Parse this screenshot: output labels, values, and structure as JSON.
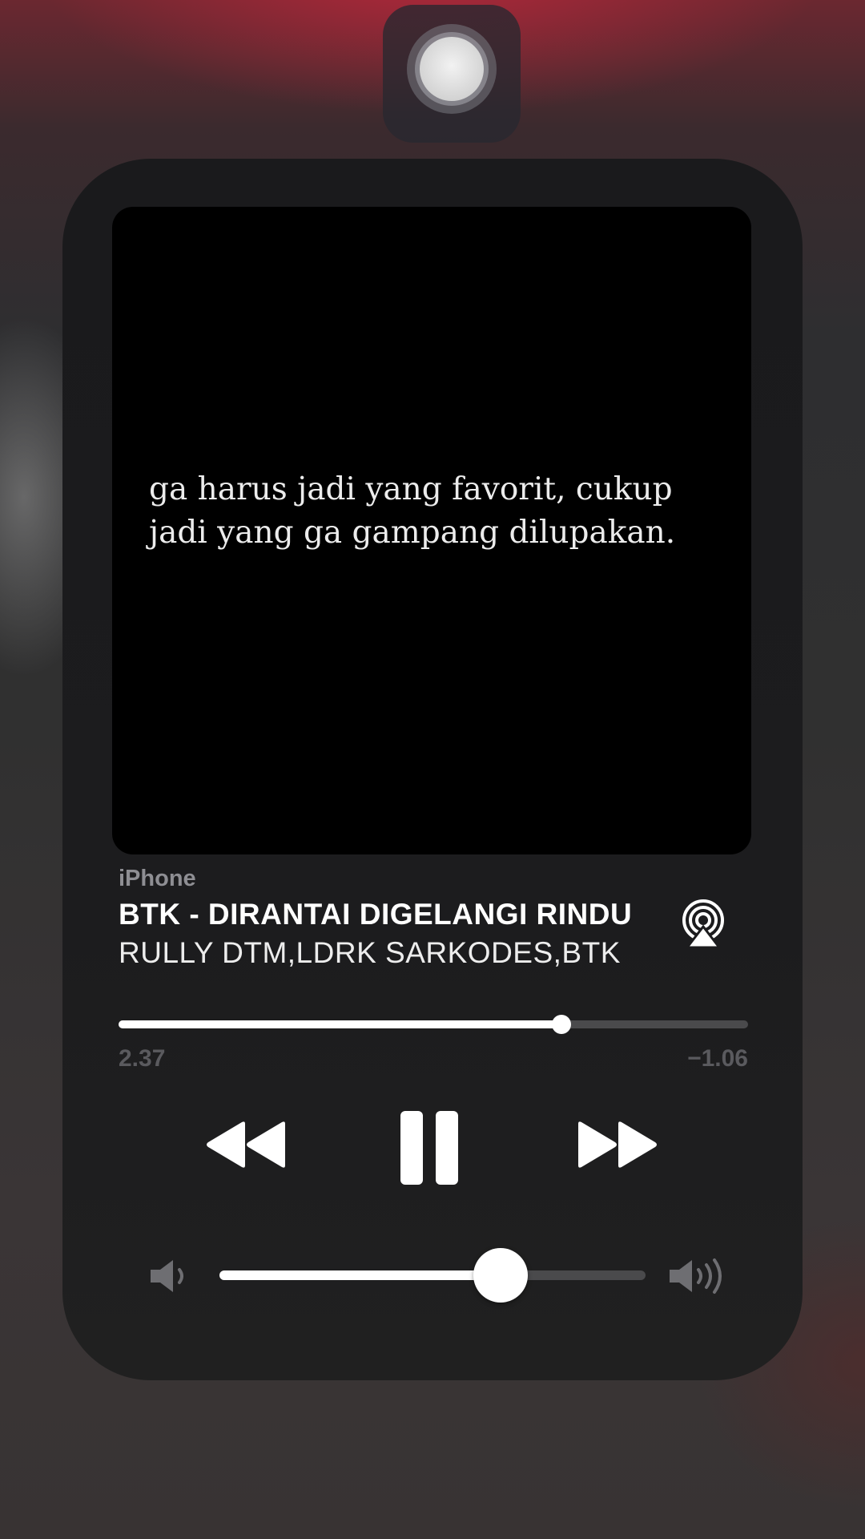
{
  "top_button": {
    "icon": "assistive-touch-icon"
  },
  "now_playing": {
    "artwork": {
      "quote": "ga harus jadi yang favorit, cukup\njadi yang ga gampang dilupakan."
    },
    "device": "iPhone",
    "title": "BTK - DIRANTAI DIGELANGI RINDU",
    "artist": "RULLY DTM,LDRK SARKODES,BTK",
    "airplay_icon": "airplay-icon",
    "progress": {
      "elapsed": "2.37",
      "remaining": "−1.06",
      "fraction": 0.703
    },
    "controls": {
      "rewind_icon": "rewind-icon",
      "pause_icon": "pause-icon",
      "forward_icon": "fast-forward-icon"
    },
    "volume": {
      "low_icon": "speaker-low-icon",
      "high_icon": "speaker-high-icon",
      "level": 0.66
    }
  },
  "colors": {
    "accent": "#ffffff",
    "track": "#4a4a4c",
    "card": "#1c1c1e",
    "secondary_text": "#8e8e93"
  }
}
